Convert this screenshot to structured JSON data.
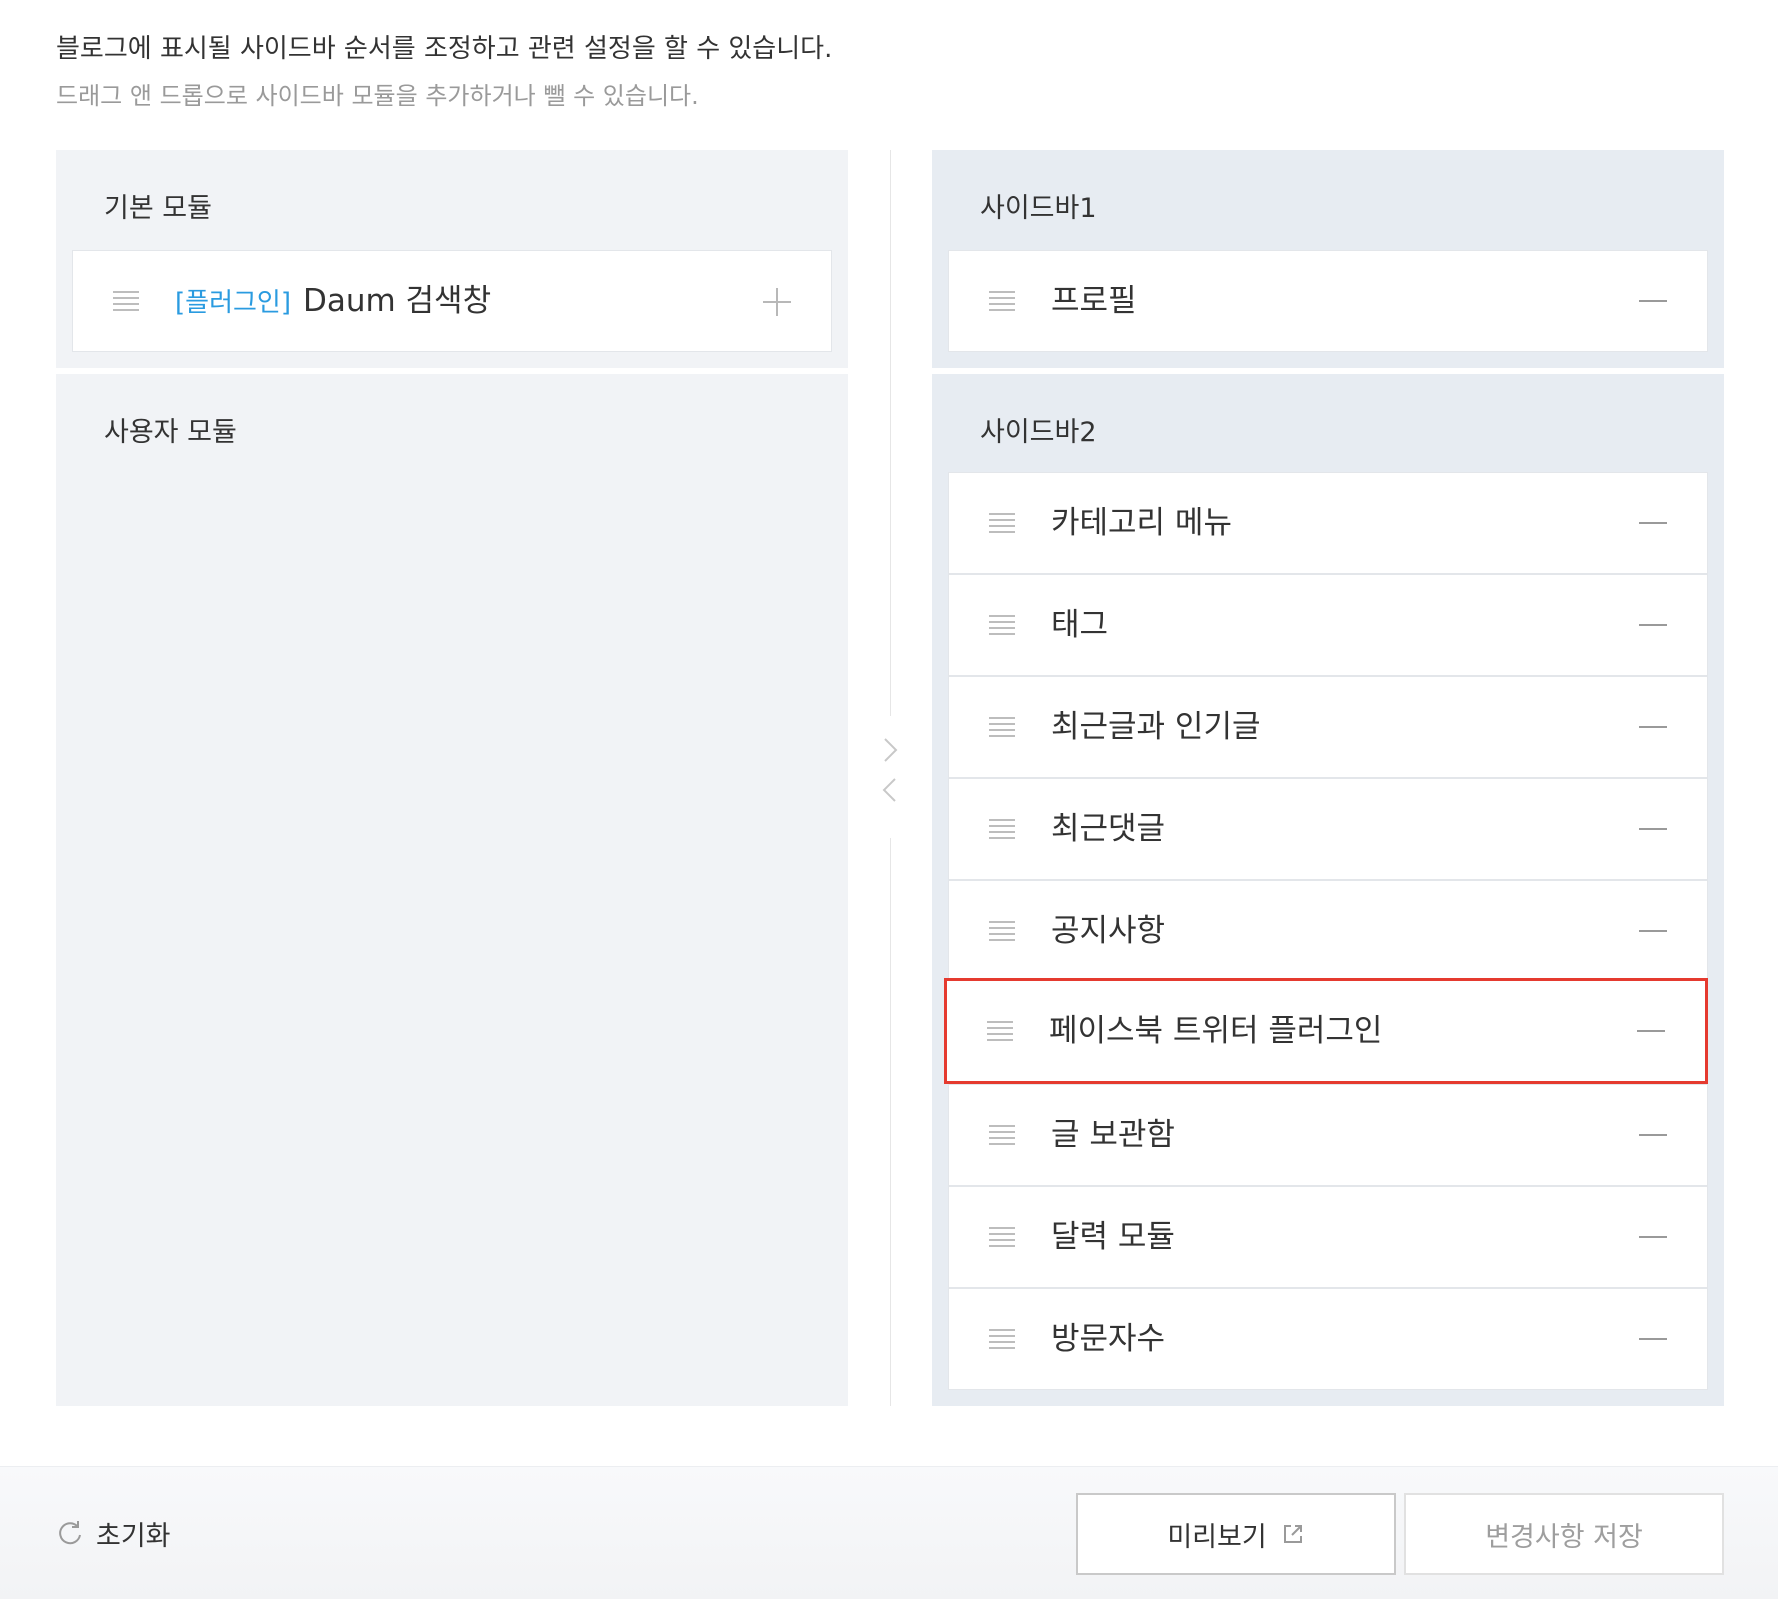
{
  "header": {
    "description": "블로그에 표시될 사이드바 순서를 조정하고 관련 설정을 할 수 있습니다.",
    "hint": "드래그 앤 드롭으로 사이드바 모듈을 추가하거나 뺄 수 있습니다."
  },
  "left": {
    "basic_title": "기본 모듈",
    "basic_items": [
      {
        "tag": "[플러그인]",
        "label": "Daum 검색창"
      }
    ],
    "user_title": "사용자 모듈"
  },
  "right": {
    "sidebar1_title": "사이드바1",
    "sidebar1_items": [
      {
        "label": "프로필"
      }
    ],
    "sidebar2_title": "사이드바2",
    "sidebar2_items": [
      {
        "label": "카테고리 메뉴"
      },
      {
        "label": "태그"
      },
      {
        "label": "최근글과 인기글"
      },
      {
        "label": "최근댓글"
      },
      {
        "label": "공지사항"
      },
      {
        "label": "페이스북 트위터 플러그인",
        "highlighted": true
      },
      {
        "label": "글 보관함"
      },
      {
        "label": "달력 모듈"
      },
      {
        "label": "방문자수"
      }
    ]
  },
  "footer": {
    "reset_label": "초기화",
    "preview_label": "미리보기",
    "save_label": "변경사항 저장"
  },
  "colors": {
    "plugin_tag": "#2a9be0",
    "highlight_border": "#e53a2f",
    "left_panel_bg": "#f1f3f6",
    "right_panel_bg": "#e7ecf2"
  },
  "icons": {
    "drag": "drag-handle-icon",
    "add": "plus-icon",
    "remove": "minus-icon",
    "move_right": "chevron-right-icon",
    "move_left": "chevron-left-icon",
    "reset": "refresh-icon",
    "external": "external-link-icon"
  }
}
